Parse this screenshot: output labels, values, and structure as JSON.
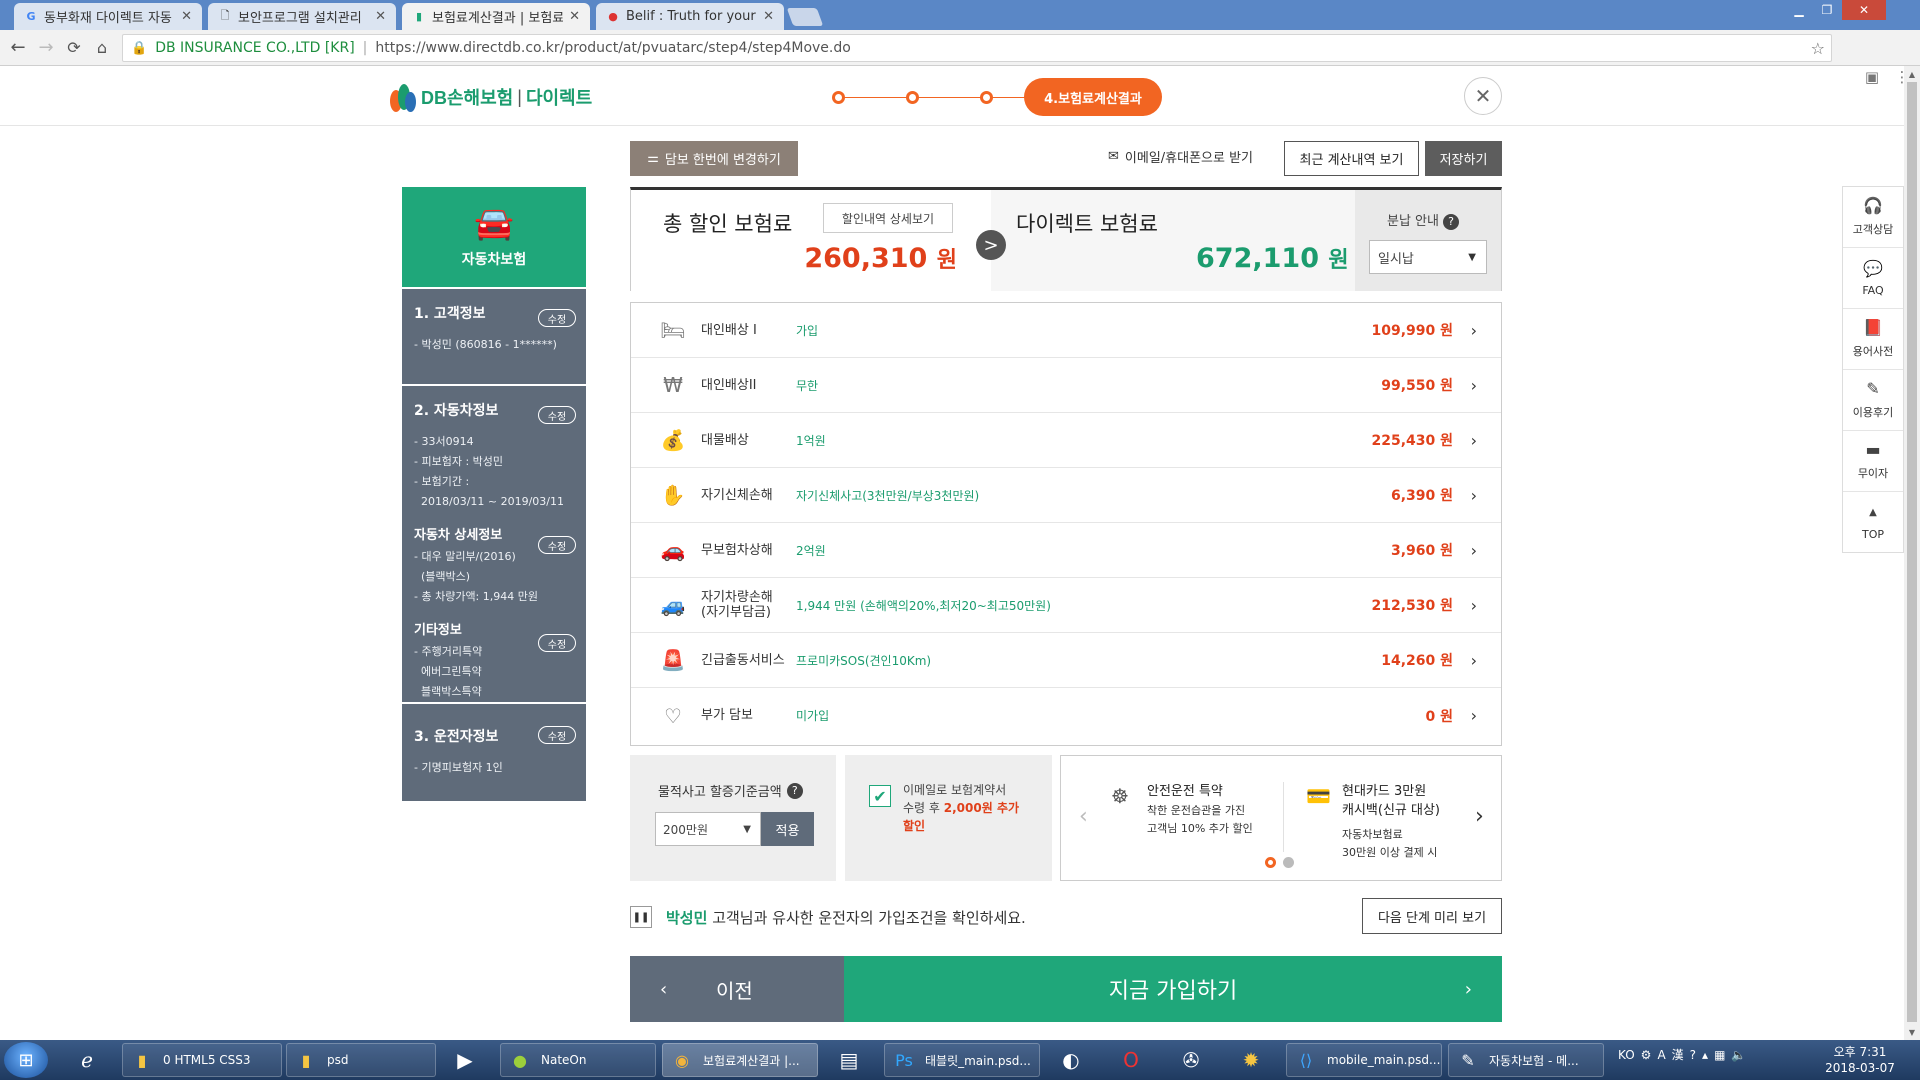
{
  "browser": {
    "tabs": [
      {
        "title": "동부화재 다이렉트 자동",
        "favicon": "google-icon"
      },
      {
        "title": "보안프로그램 설치관리",
        "favicon": "document-icon"
      },
      {
        "title": "보험료계산결과 | 보험료",
        "favicon": "db-icon"
      },
      {
        "title": "Belif : Truth for your sk",
        "favicon": "belif-icon"
      }
    ],
    "address": {
      "org": "DB INSURANCE CO.,LTD [KR]",
      "url": "https://www.directdb.co.kr/product/at/pvuatarc/step4/step4Move.do"
    }
  },
  "header": {
    "logo_db": "DB손해보험",
    "logo_sep": "|",
    "logo_direct": "다이렉트",
    "current_step": "4.보험료계산결과",
    "close": "✕"
  },
  "sidebar": {
    "title": "자동차보험",
    "edit_label": "수정",
    "sections": [
      {
        "heading": "1. 고객정보",
        "lines": [
          "- 박성민 (860816 - 1******)"
        ]
      },
      {
        "heading": "2. 자동차정보",
        "lines": [
          "- 33서0914",
          "- 피보험자 : 박성민",
          "- 보험기간 :",
          "2018/03/11 ~ 2019/03/11"
        ]
      },
      {
        "heading": "자동차 상세정보",
        "lines": [
          "- 대우 말리부/(2016)",
          "(블랙박스)",
          "- 총 차량가액: 1,944 만원"
        ]
      },
      {
        "heading": "기타정보",
        "lines": [
          "- 주행거리특약",
          "에버그린특약",
          "블랙박스특약"
        ]
      },
      {
        "heading": "3. 운전자정보",
        "lines": [
          "- 기명피보험자 1인"
        ]
      }
    ]
  },
  "actions": {
    "change_all": "담보 한번에 변경하기",
    "email_phone": "이메일/휴대폰으로 받기",
    "recent": "최근 계산내역 보기",
    "save": "저장하기"
  },
  "summary": {
    "total_label": "총 할인 보험료",
    "detail_btn": "할인내역 상세보기",
    "total_amount": "260,310",
    "direct_label": "다이렉트 보험료",
    "direct_amount": "672,110",
    "unit": "원",
    "installment_label": "분납 안내",
    "installment_value": "일시납"
  },
  "coverages": [
    {
      "icon": "bed-icon",
      "name": "대인배상 I",
      "value": "가입",
      "amount": "109,990 원"
    },
    {
      "icon": "won-coin-icon",
      "name": "대인배상II",
      "value": "무한",
      "amount": "99,550 원"
    },
    {
      "icon": "money-bag-icon",
      "name": "대물배상",
      "value": "1억원",
      "amount": "225,430 원"
    },
    {
      "icon": "hand-injury-icon",
      "name": "자기신체손해",
      "value": "자기신체사고(3천만원/부상3천만원)",
      "amount": "6,390 원"
    },
    {
      "icon": "car-crash-icon",
      "name": "무보험차상해",
      "value": "2억원",
      "amount": "3,960 원"
    },
    {
      "icon": "car-damage-icon",
      "name": "자기차량손해",
      "name2": "(자기부담금)",
      "value": "1,944 만원 (손해액의20%,최저20~최고50만원)",
      "amount": "212,530 원"
    },
    {
      "icon": "siren-icon",
      "name": "긴급출동서비스",
      "value": "프로미카SOS(견인10Km)",
      "amount": "14,260 원"
    },
    {
      "icon": "heart-icon",
      "name": "부가 담보",
      "value": "미가입",
      "amount": "0 원"
    }
  ],
  "panels": {
    "property_label": "물적사고 할증기준금액",
    "property_value": "200만원",
    "apply": "적용",
    "email_text_1": "이메일로 보험계약서",
    "email_text_2": "수령 후",
    "email_highlight": "2,000원 추가",
    "email_text_3": "할인",
    "promo1_title": "안전운전 특약",
    "promo1_desc1": "착한 운전습관을 가진",
    "promo1_desc2": "고객님 10% 추가 할인",
    "promo2_title1": "현대카드 3만원",
    "promo2_title2": "캐시백(신규 대상)",
    "promo2_desc1": "자동차보험료",
    "promo2_desc2": "30만원 이상 결제 시",
    "slide_index": 1,
    "slide_count": 2
  },
  "similar": {
    "name": "박성민",
    "text": "고객님과 유사한 운전자의 가입조건을 확인하세요.",
    "next_preview": "다음 단계 미리 보기"
  },
  "bottom": {
    "prev": "이전",
    "join": "지금 가입하기"
  },
  "quickmenu": [
    {
      "icon": "headset-icon",
      "label": "고객상담"
    },
    {
      "icon": "faq-icon",
      "label": "FAQ"
    },
    {
      "icon": "book-icon",
      "label": "용어사전"
    },
    {
      "icon": "pencil-icon",
      "label": "이용후기"
    },
    {
      "icon": "card-icon",
      "label": "무이자"
    },
    {
      "icon": "up-icon",
      "label": "TOP"
    }
  ],
  "taskbar": {
    "items": [
      {
        "label": "0 HTML5 CSS3",
        "icon": "folder-icon"
      },
      {
        "label": "psd",
        "icon": "folder-icon"
      },
      {
        "label": "NateOn",
        "icon": "nateon-icon"
      },
      {
        "label": "보험료계산결과 |...",
        "icon": "chrome-icon"
      },
      {
        "label": "태블릿_main.psd...",
        "icon": "photoshop-icon"
      },
      {
        "label": "mobile_main.psd...",
        "icon": "vscode-icon"
      },
      {
        "label": "자동차보험 - 메...",
        "icon": "notepad-icon"
      }
    ],
    "tray_lang": "KO",
    "time": "오후 7:31",
    "date": "2018-03-07"
  },
  "colors": {
    "brand_green": "#1fa77a",
    "accent_orange": "#f26522",
    "price_red": "#e0401a",
    "sidebar_gray": "#5f6b7a"
  }
}
